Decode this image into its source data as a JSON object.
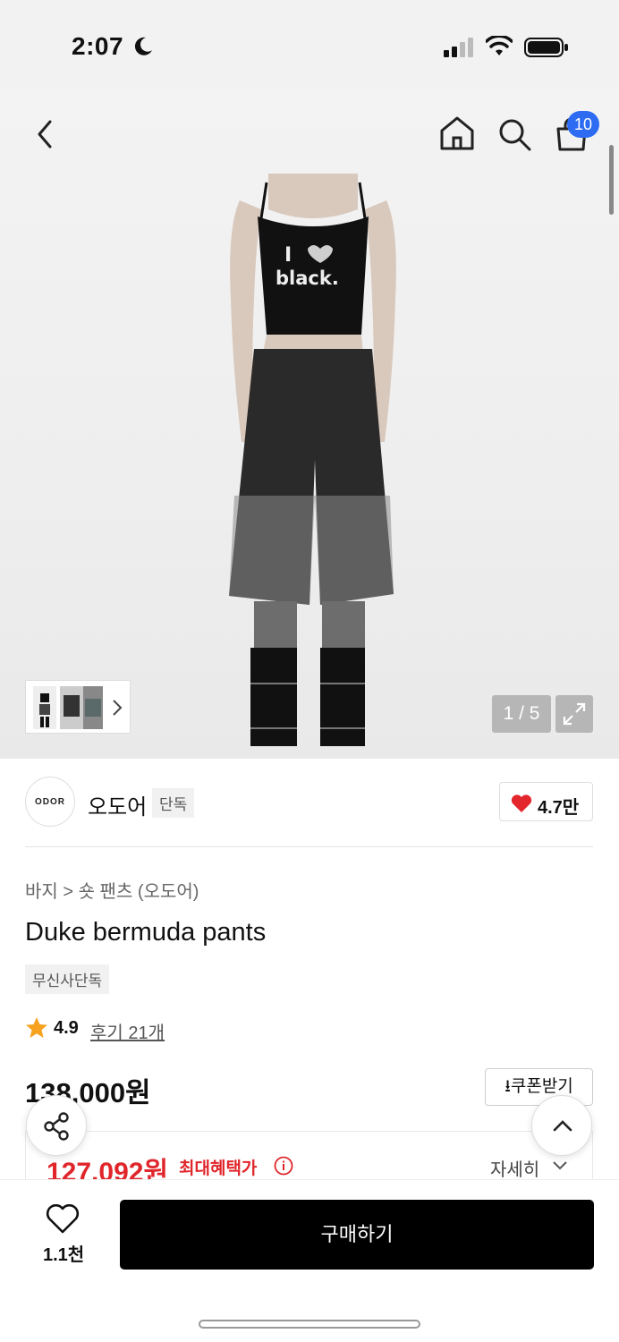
{
  "status_bar": {
    "time": "2:07"
  },
  "nav": {
    "cart_count": "10"
  },
  "gallery": {
    "counter": "1 / 5",
    "shirt_text_line1": "I",
    "shirt_text_line2": "black."
  },
  "brand": {
    "logo_text": "ODOR",
    "name": "오도어",
    "tag": "단독",
    "likes": "4.7만"
  },
  "product": {
    "breadcrumb": "바지 > 숏 팬츠 (오도어)",
    "title": "Duke bermuda pants",
    "exclusive_tag": "무신사단독",
    "rating": "4.9",
    "reviews": "후기 21개",
    "original_price": "138,000원",
    "coupon_label": "쿠폰받기",
    "sale_price": "127,092원",
    "sale_label": "최대혜택가",
    "detail_label": "자세히"
  },
  "bottom_bar": {
    "wish_count": "1.1천",
    "buy_label": "구매하기"
  },
  "colors": {
    "accent_red": "#e0262b",
    "badge_blue": "#2d6bf3",
    "heart_red": "#e3252c",
    "star_orange": "#f6a21e"
  }
}
